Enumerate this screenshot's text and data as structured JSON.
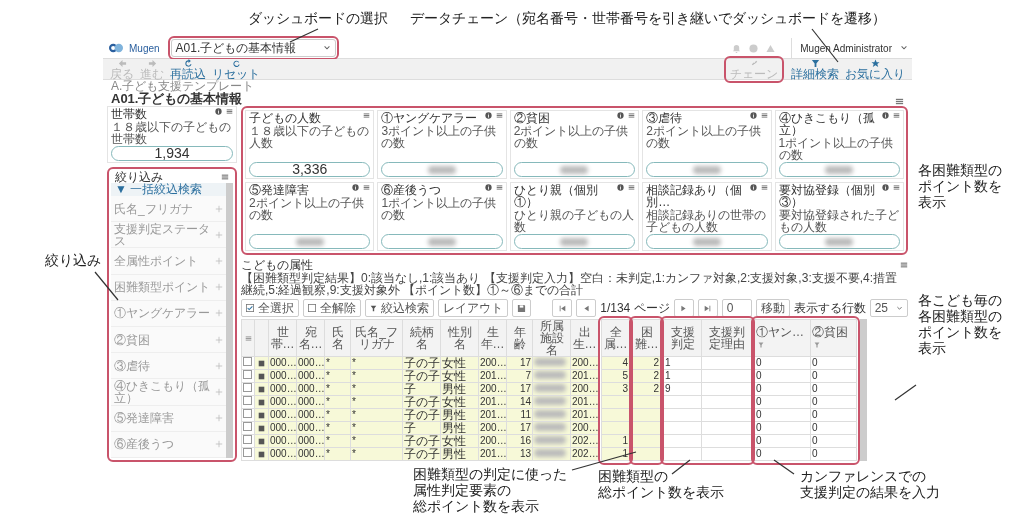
{
  "annotations": {
    "dashboard_select": "ダッシュボードの選択",
    "data_chain": "データチェーン（宛名番号・世帯番号を引き継いでダッシュボードを遷移）",
    "filter": "絞り込み",
    "cards": [
      "各困難類型の",
      "ポイント数を",
      "表示"
    ],
    "columns": [
      "各こども毎の",
      "各困難類型の",
      "ポイント数を",
      "表示"
    ],
    "attribute_points": [
      "困難類型の判定に使った",
      "属性判定要素の",
      "総ポイント数を表示"
    ],
    "type_points": [
      "困難類型の",
      "総ポイント数を表示"
    ],
    "conference": [
      "カンファレンスでの",
      "支援判定の結果を入力"
    ]
  },
  "header": {
    "logo": "Mugen",
    "dashboard": "A01.子どもの基本情報",
    "user": "Mugen Administrator"
  },
  "toolbar": {
    "left": [
      {
        "label": "戻る",
        "kind": "back",
        "disabled": true
      },
      {
        "label": "進む",
        "kind": "forward",
        "disabled": true
      },
      {
        "label": "再読込",
        "kind": "reload",
        "disabled": false
      },
      {
        "label": "リセット",
        "kind": "reset",
        "disabled": false
      }
    ],
    "right": [
      {
        "label": "チェーン",
        "kind": "chain",
        "disabled": true
      },
      {
        "label": "詳細検索",
        "kind": "filter",
        "disabled": false
      },
      {
        "label": "お気に入り",
        "kind": "star",
        "disabled": false
      }
    ]
  },
  "breadcrumb": "A.子ども支援テンプレート",
  "title": "A01.子どもの基本情報",
  "household_card": {
    "title": "世帯数",
    "subtitle": "１８歳以下の子どもの世帯数",
    "value": "1,934",
    "info": true
  },
  "kpi_cards": [
    {
      "title": "子どもの人数",
      "subtitle": "１８歳以下の子どもの人数",
      "value": "3,336",
      "info": false,
      "blurred": false
    },
    {
      "title": "①ヤングケアラー",
      "subtitle": "3ポイント以上の子供の数",
      "info": true,
      "blurred": true
    },
    {
      "title": "②貧困",
      "subtitle": "2ポイント以上の子供の数",
      "info": true,
      "blurred": true
    },
    {
      "title": "③虐待",
      "subtitle": "2ポイント以上の子供の数",
      "info": true,
      "blurred": true
    },
    {
      "title": "④ひきこもり（孤立）",
      "subtitle": "1ポイント以上の子供の数",
      "info": true,
      "blurred": true
    },
    {
      "title": "⑤発達障害",
      "subtitle": "2ポイント以上の子供の数",
      "info": true,
      "blurred": true
    },
    {
      "title": "⑥産後うつ",
      "subtitle": "1ポイント以上の子供の数",
      "info": true,
      "blurred": true
    },
    {
      "title": "ひとり親（個別①）",
      "subtitle": "ひとり親の子どもの人数",
      "info": true,
      "blurred": true
    },
    {
      "title": "相談記録あり（個別…",
      "subtitle": "相談記録ありの世帯の子どもの人数",
      "info": true,
      "blurred": true
    },
    {
      "title": "要対協登録（個別③）",
      "subtitle": "要対協登録された子どもの人数",
      "info": true,
      "blurred": true
    }
  ],
  "filter": {
    "title": "絞り込み",
    "bulk_search": "▼ 一括絞込検索",
    "items": [
      "氏名_フリガナ",
      "支援判定ステータス",
      "全属性ポイント",
      "困難類型ポイント",
      "①ヤングケアラー",
      "②貧困",
      "③虐待",
      "④ひきこもり（孤立）",
      "⑤発達障害",
      "⑥産後うつ"
    ]
  },
  "table_section": {
    "title": "こどもの属性",
    "legend": "【困難類型判定結果】0:該当なし,1:該当あり 【支援判定入力】空白：未判定,1:カンファ対象,2:支援対象,3:支援不要,4:措置継続,5:経過観察,9:支援対象外 【ポイント数】①～⑥までの合計",
    "buttons": [
      {
        "label": "全選択",
        "kind": "check"
      },
      {
        "label": "全解除",
        "kind": "box"
      },
      {
        "label": "絞込検索",
        "kind": "filter"
      },
      {
        "label": "レイアウト",
        "kind": "plain"
      },
      {
        "kind": "save"
      }
    ],
    "pager": {
      "page": "1/134 ページ",
      "page_input": "0",
      "go": "移動",
      "rows_label": "表示する行数",
      "rows_per_page": "25"
    },
    "columns": [
      {
        "kind": "check"
      },
      {
        "kind": "icon"
      },
      {
        "label": "世帯…",
        "kind": "code"
      },
      {
        "label": "宛名…",
        "kind": "code"
      },
      {
        "label": "氏名",
        "kind": "code"
      },
      {
        "label": "氏名_フリガナ",
        "kind": "code"
      },
      {
        "label": "続柄名",
        "kind": "text"
      },
      {
        "label": "性別名",
        "kind": "text"
      },
      {
        "label": "生年…",
        "kind": "code"
      },
      {
        "label": "年齢",
        "kind": "num"
      },
      {
        "label": "所属施設名",
        "kind": "blur"
      },
      {
        "label": "出生…",
        "kind": "code"
      },
      {
        "label": "全属…",
        "kind": "num"
      },
      {
        "label": "困難…",
        "kind": "num"
      },
      {
        "label": "支援判定",
        "kind": "input"
      },
      {
        "label": "支援判定理由",
        "kind": "input"
      },
      {
        "label": "①ヤン…",
        "kind": "input",
        "filter": true
      },
      {
        "label": "②貧困",
        "kind": "input",
        "filter": true
      }
    ],
    "rows": [
      {
        "checked": false,
        "cells": [
          null,
          null,
          "000…",
          "000…",
          "*",
          "*",
          "子の子",
          "女性",
          "200…",
          "17",
          null,
          "200…",
          "4",
          "2",
          "1",
          null,
          "0",
          "0"
        ]
      },
      {
        "checked": false,
        "cells": [
          null,
          null,
          "000…",
          "000…",
          "*",
          "*",
          "子の子",
          "女性",
          "201…",
          "7",
          null,
          "201…",
          "5",
          "2",
          "1",
          null,
          "0",
          "0"
        ]
      },
      {
        "checked": false,
        "cells": [
          null,
          null,
          "000…",
          "000…",
          "*",
          "*",
          "子",
          "男性",
          "200…",
          "17",
          null,
          "200…",
          "3",
          "2",
          "9",
          null,
          "0",
          "0"
        ]
      },
      {
        "checked": false,
        "cells": [
          null,
          null,
          "000…",
          "000…",
          "*",
          "*",
          "子の子",
          "女性",
          "201…",
          "14",
          null,
          "201…",
          null,
          null,
          null,
          null,
          "0",
          "0"
        ]
      },
      {
        "checked": false,
        "cells": [
          null,
          null,
          "000…",
          "000…",
          "*",
          "*",
          "子の子",
          "男性",
          "201…",
          "11",
          null,
          "201…",
          null,
          null,
          null,
          null,
          "0",
          "0"
        ]
      },
      {
        "checked": false,
        "cells": [
          null,
          null,
          "000…",
          "000…",
          "*",
          "*",
          "子",
          "男性",
          "200…",
          "17",
          null,
          "200…",
          null,
          null,
          null,
          null,
          "0",
          "0"
        ]
      },
      {
        "checked": false,
        "cells": [
          null,
          null,
          "000…",
          "000…",
          "*",
          "*",
          "子の子",
          "女性",
          "200…",
          "16",
          null,
          "202…",
          "1",
          null,
          null,
          null,
          "0",
          "0"
        ]
      },
      {
        "checked": false,
        "cells": [
          null,
          null,
          "000…",
          "000…",
          "*",
          "*",
          "子の子",
          "男性",
          "201…",
          "13",
          null,
          "202…",
          "1",
          null,
          null,
          null,
          "0",
          "0"
        ]
      }
    ]
  }
}
